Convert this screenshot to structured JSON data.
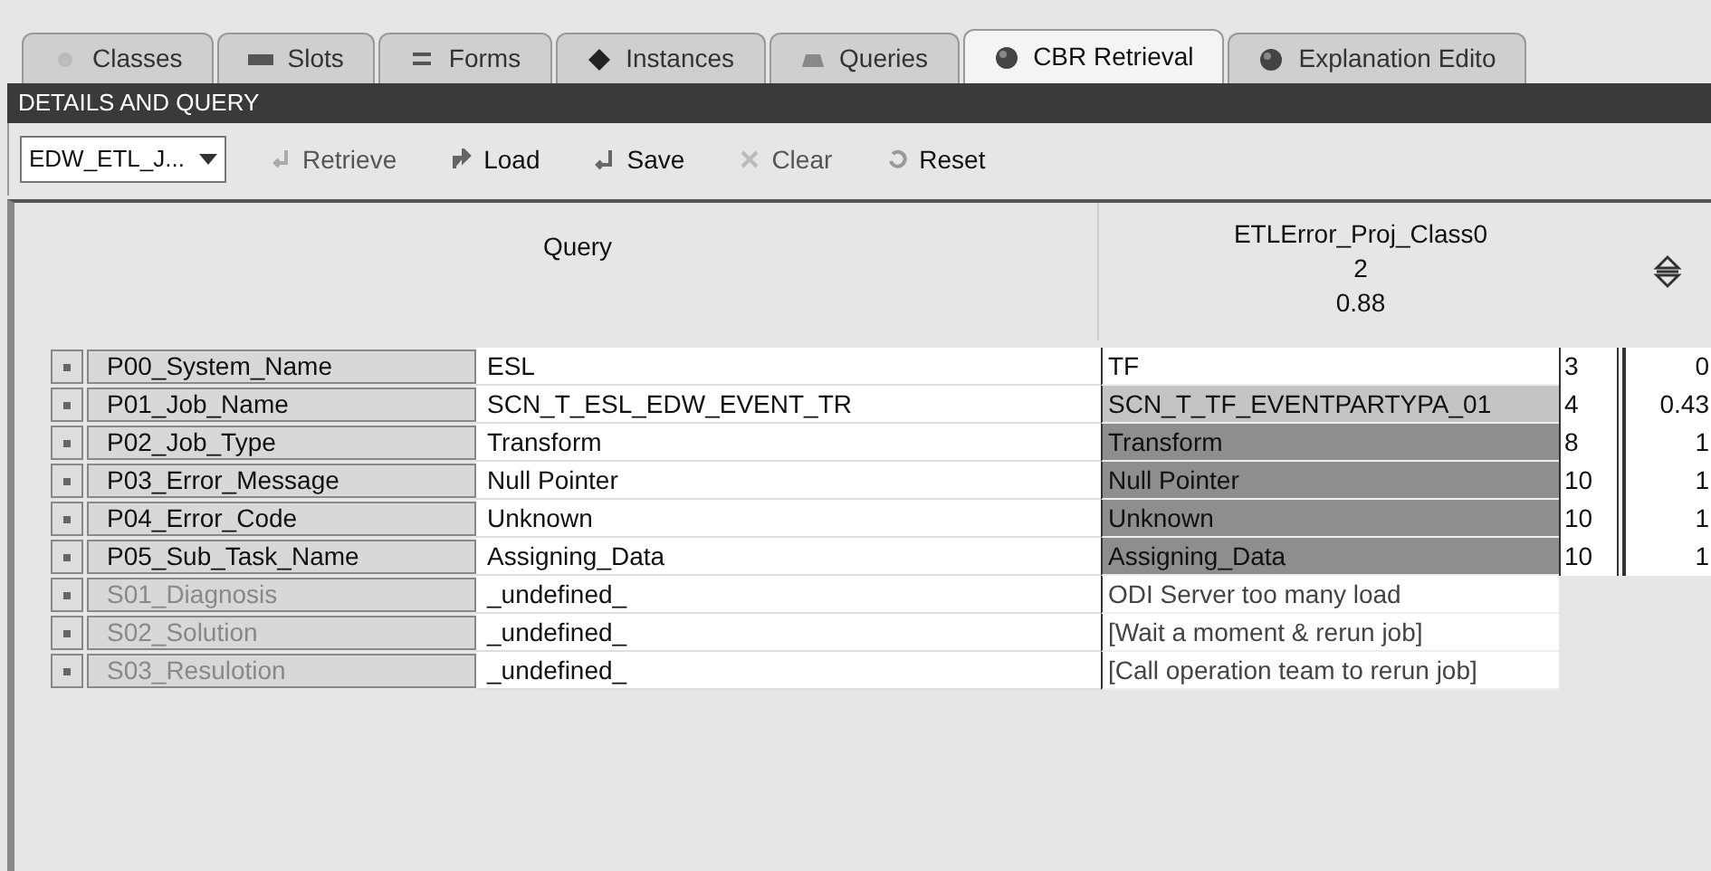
{
  "tabs": [
    {
      "label": "Classes",
      "selected": false
    },
    {
      "label": "Slots",
      "selected": false
    },
    {
      "label": "Forms",
      "selected": false
    },
    {
      "label": "Instances",
      "selected": false
    },
    {
      "label": "Queries",
      "selected": false
    },
    {
      "label": "CBR Retrieval",
      "selected": true
    },
    {
      "label": "Explanation Edito",
      "selected": false
    }
  ],
  "panel_title": "DETAILS AND QUERY",
  "toolbar": {
    "case_select": "EDW_ETL_J...",
    "buttons": [
      {
        "label": "Retrieve",
        "disabled": true
      },
      {
        "label": "Load",
        "disabled": false
      },
      {
        "label": "Save",
        "disabled": false
      },
      {
        "label": "Clear",
        "disabled": true
      },
      {
        "label": "Reset",
        "disabled": false
      }
    ]
  },
  "table": {
    "query_header": "Query",
    "case_header": [
      "ETLError_Proj_Class0",
      "2",
      "0.88"
    ],
    "rows": [
      {
        "kind": "problem",
        "attribute": "P00_System_Name",
        "query": "ESL",
        "case_value": "TF",
        "color": "#ffffff",
        "weight": "3",
        "similarity": "0"
      },
      {
        "kind": "problem",
        "attribute": "P01_Job_Name",
        "query": "SCN_T_ESL_EDW_EVENT_TR",
        "case_value": "SCN_T_TF_EVENTPARTYPA_01",
        "color": "#c4c4c4",
        "weight": "4",
        "similarity": "0.43"
      },
      {
        "kind": "problem",
        "attribute": "P02_Job_Type",
        "query": "Transform",
        "case_value": "Transform",
        "color": "#8e8e8e",
        "weight": "8",
        "similarity": "1"
      },
      {
        "kind": "problem",
        "attribute": "P03_Error_Message",
        "query": "Null Pointer",
        "case_value": "Null Pointer",
        "color": "#8e8e8e",
        "weight": "10",
        "similarity": "1"
      },
      {
        "kind": "problem",
        "attribute": "P04_Error_Code",
        "query": "Unknown",
        "case_value": "Unknown",
        "color": "#8e8e8e",
        "weight": "10",
        "similarity": "1"
      },
      {
        "kind": "problem",
        "attribute": "P05_Sub_Task_Name",
        "query": "Assigning_Data",
        "case_value": "Assigning_Data",
        "color": "#8e8e8e",
        "weight": "10",
        "similarity": "1"
      },
      {
        "kind": "solution",
        "attribute": "S01_Diagnosis",
        "query": "_undefined_",
        "case_value": "ODI Server too many load"
      },
      {
        "kind": "solution",
        "attribute": "S02_Solution",
        "query": "_undefined_",
        "case_value": "[Wait a moment & rerun job]"
      },
      {
        "kind": "solution",
        "attribute": "S03_Resulotion",
        "query": "_undefined_",
        "case_value": "[Call operation team to rerun job]"
      }
    ]
  }
}
